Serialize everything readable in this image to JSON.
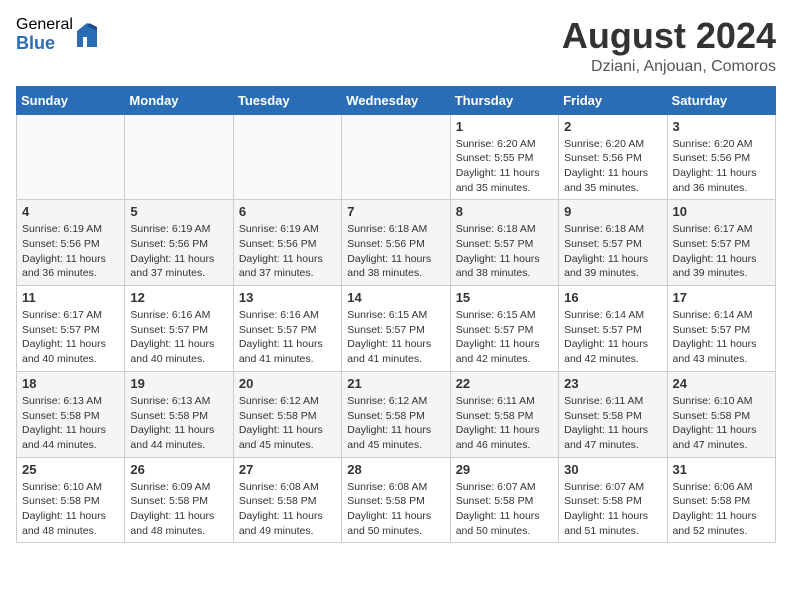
{
  "header": {
    "logo_general": "General",
    "logo_blue": "Blue",
    "month_year": "August 2024",
    "location": "Dziani, Anjouan, Comoros"
  },
  "days_of_week": [
    "Sunday",
    "Monday",
    "Tuesday",
    "Wednesday",
    "Thursday",
    "Friday",
    "Saturday"
  ],
  "weeks": [
    [
      {
        "day": "",
        "sunrise": "",
        "sunset": "",
        "daylight": ""
      },
      {
        "day": "",
        "sunrise": "",
        "sunset": "",
        "daylight": ""
      },
      {
        "day": "",
        "sunrise": "",
        "sunset": "",
        "daylight": ""
      },
      {
        "day": "",
        "sunrise": "",
        "sunset": "",
        "daylight": ""
      },
      {
        "day": "1",
        "sunrise": "Sunrise: 6:20 AM",
        "sunset": "Sunset: 5:55 PM",
        "daylight": "Daylight: 11 hours and 35 minutes."
      },
      {
        "day": "2",
        "sunrise": "Sunrise: 6:20 AM",
        "sunset": "Sunset: 5:56 PM",
        "daylight": "Daylight: 11 hours and 35 minutes."
      },
      {
        "day": "3",
        "sunrise": "Sunrise: 6:20 AM",
        "sunset": "Sunset: 5:56 PM",
        "daylight": "Daylight: 11 hours and 36 minutes."
      }
    ],
    [
      {
        "day": "4",
        "sunrise": "Sunrise: 6:19 AM",
        "sunset": "Sunset: 5:56 PM",
        "daylight": "Daylight: 11 hours and 36 minutes."
      },
      {
        "day": "5",
        "sunrise": "Sunrise: 6:19 AM",
        "sunset": "Sunset: 5:56 PM",
        "daylight": "Daylight: 11 hours and 37 minutes."
      },
      {
        "day": "6",
        "sunrise": "Sunrise: 6:19 AM",
        "sunset": "Sunset: 5:56 PM",
        "daylight": "Daylight: 11 hours and 37 minutes."
      },
      {
        "day": "7",
        "sunrise": "Sunrise: 6:18 AM",
        "sunset": "Sunset: 5:56 PM",
        "daylight": "Daylight: 11 hours and 38 minutes."
      },
      {
        "day": "8",
        "sunrise": "Sunrise: 6:18 AM",
        "sunset": "Sunset: 5:57 PM",
        "daylight": "Daylight: 11 hours and 38 minutes."
      },
      {
        "day": "9",
        "sunrise": "Sunrise: 6:18 AM",
        "sunset": "Sunset: 5:57 PM",
        "daylight": "Daylight: 11 hours and 39 minutes."
      },
      {
        "day": "10",
        "sunrise": "Sunrise: 6:17 AM",
        "sunset": "Sunset: 5:57 PM",
        "daylight": "Daylight: 11 hours and 39 minutes."
      }
    ],
    [
      {
        "day": "11",
        "sunrise": "Sunrise: 6:17 AM",
        "sunset": "Sunset: 5:57 PM",
        "daylight": "Daylight: 11 hours and 40 minutes."
      },
      {
        "day": "12",
        "sunrise": "Sunrise: 6:16 AM",
        "sunset": "Sunset: 5:57 PM",
        "daylight": "Daylight: 11 hours and 40 minutes."
      },
      {
        "day": "13",
        "sunrise": "Sunrise: 6:16 AM",
        "sunset": "Sunset: 5:57 PM",
        "daylight": "Daylight: 11 hours and 41 minutes."
      },
      {
        "day": "14",
        "sunrise": "Sunrise: 6:15 AM",
        "sunset": "Sunset: 5:57 PM",
        "daylight": "Daylight: 11 hours and 41 minutes."
      },
      {
        "day": "15",
        "sunrise": "Sunrise: 6:15 AM",
        "sunset": "Sunset: 5:57 PM",
        "daylight": "Daylight: 11 hours and 42 minutes."
      },
      {
        "day": "16",
        "sunrise": "Sunrise: 6:14 AM",
        "sunset": "Sunset: 5:57 PM",
        "daylight": "Daylight: 11 hours and 42 minutes."
      },
      {
        "day": "17",
        "sunrise": "Sunrise: 6:14 AM",
        "sunset": "Sunset: 5:57 PM",
        "daylight": "Daylight: 11 hours and 43 minutes."
      }
    ],
    [
      {
        "day": "18",
        "sunrise": "Sunrise: 6:13 AM",
        "sunset": "Sunset: 5:58 PM",
        "daylight": "Daylight: 11 hours and 44 minutes."
      },
      {
        "day": "19",
        "sunrise": "Sunrise: 6:13 AM",
        "sunset": "Sunset: 5:58 PM",
        "daylight": "Daylight: 11 hours and 44 minutes."
      },
      {
        "day": "20",
        "sunrise": "Sunrise: 6:12 AM",
        "sunset": "Sunset: 5:58 PM",
        "daylight": "Daylight: 11 hours and 45 minutes."
      },
      {
        "day": "21",
        "sunrise": "Sunrise: 6:12 AM",
        "sunset": "Sunset: 5:58 PM",
        "daylight": "Daylight: 11 hours and 45 minutes."
      },
      {
        "day": "22",
        "sunrise": "Sunrise: 6:11 AM",
        "sunset": "Sunset: 5:58 PM",
        "daylight": "Daylight: 11 hours and 46 minutes."
      },
      {
        "day": "23",
        "sunrise": "Sunrise: 6:11 AM",
        "sunset": "Sunset: 5:58 PM",
        "daylight": "Daylight: 11 hours and 47 minutes."
      },
      {
        "day": "24",
        "sunrise": "Sunrise: 6:10 AM",
        "sunset": "Sunset: 5:58 PM",
        "daylight": "Daylight: 11 hours and 47 minutes."
      }
    ],
    [
      {
        "day": "25",
        "sunrise": "Sunrise: 6:10 AM",
        "sunset": "Sunset: 5:58 PM",
        "daylight": "Daylight: 11 hours and 48 minutes."
      },
      {
        "day": "26",
        "sunrise": "Sunrise: 6:09 AM",
        "sunset": "Sunset: 5:58 PM",
        "daylight": "Daylight: 11 hours and 48 minutes."
      },
      {
        "day": "27",
        "sunrise": "Sunrise: 6:08 AM",
        "sunset": "Sunset: 5:58 PM",
        "daylight": "Daylight: 11 hours and 49 minutes."
      },
      {
        "day": "28",
        "sunrise": "Sunrise: 6:08 AM",
        "sunset": "Sunset: 5:58 PM",
        "daylight": "Daylight: 11 hours and 50 minutes."
      },
      {
        "day": "29",
        "sunrise": "Sunrise: 6:07 AM",
        "sunset": "Sunset: 5:58 PM",
        "daylight": "Daylight: 11 hours and 50 minutes."
      },
      {
        "day": "30",
        "sunrise": "Sunrise: 6:07 AM",
        "sunset": "Sunset: 5:58 PM",
        "daylight": "Daylight: 11 hours and 51 minutes."
      },
      {
        "day": "31",
        "sunrise": "Sunrise: 6:06 AM",
        "sunset": "Sunset: 5:58 PM",
        "daylight": "Daylight: 11 hours and 52 minutes."
      }
    ]
  ]
}
